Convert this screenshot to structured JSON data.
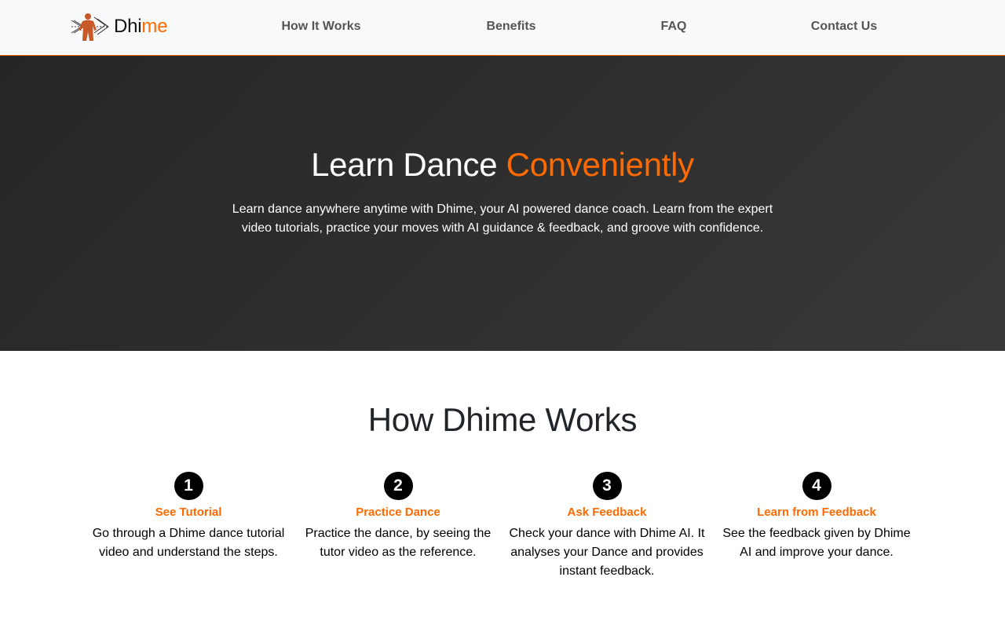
{
  "brand": {
    "name_part1": "Dhi",
    "name_part2": "me",
    "logo_icon": "dancer-arrows-icon"
  },
  "nav": {
    "links": [
      "How It Works",
      "Benefits",
      "FAQ",
      "Contact Us"
    ]
  },
  "hero": {
    "title_part1": "Learn Dance ",
    "title_accent": "Conveniently",
    "description": "Learn dance anywhere anytime with Dhime, your AI powered dance coach. Learn from the expert video tutorials, practice your moves with AI guidance & feedback, and groove with confidence."
  },
  "works": {
    "title": "How Dhime Works",
    "steps": [
      {
        "number": "1",
        "title": "See Tutorial",
        "description": "Go through a Dhime dance tutorial video and understand the steps."
      },
      {
        "number": "2",
        "title": "Practice Dance",
        "description": "Practice the dance, by seeing the tutor video as the reference."
      },
      {
        "number": "3",
        "title": "Ask Feedback",
        "description": "Check your dance with Dhime AI. It analyses your Dance and provides instant feedback."
      },
      {
        "number": "4",
        "title": "Learn from Feedback",
        "description": "See the feedback given by Dhime AI and improve your dance."
      }
    ]
  },
  "colors": {
    "accent": "#ff6a00",
    "nav_bg": "#f8f9fa",
    "hero_bg": "#2e2e2e",
    "nav_text": "#555555"
  }
}
